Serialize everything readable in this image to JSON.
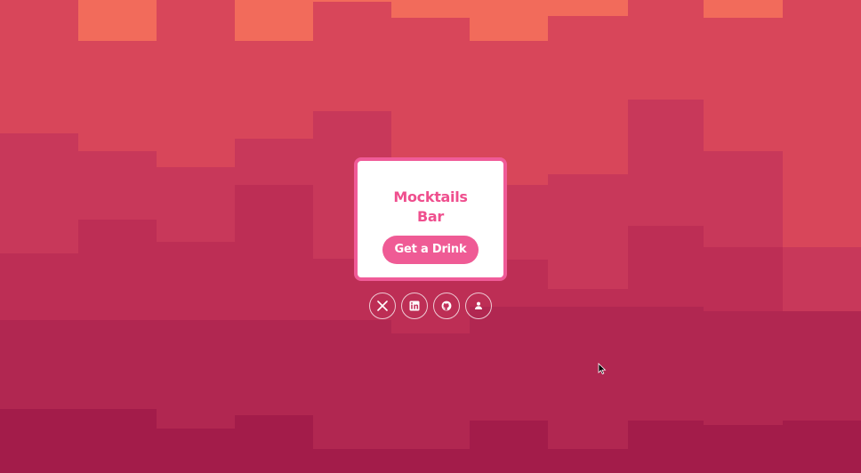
{
  "card": {
    "title_line1": "Mocktails",
    "title_line2": "Bar",
    "cta_label": "Get a Drink"
  },
  "social_links": [
    {
      "icon": "x-twitter-icon"
    },
    {
      "icon": "linkedin-icon"
    },
    {
      "icon": "github-icon"
    },
    {
      "icon": "user-icon"
    }
  ],
  "colors": {
    "card_border": "#f05b98",
    "card_title": "#ef4f8e",
    "button_bg": "#ef5b95",
    "bg_top": "#f26b5b",
    "bg_bottom": "#a31c4a"
  }
}
